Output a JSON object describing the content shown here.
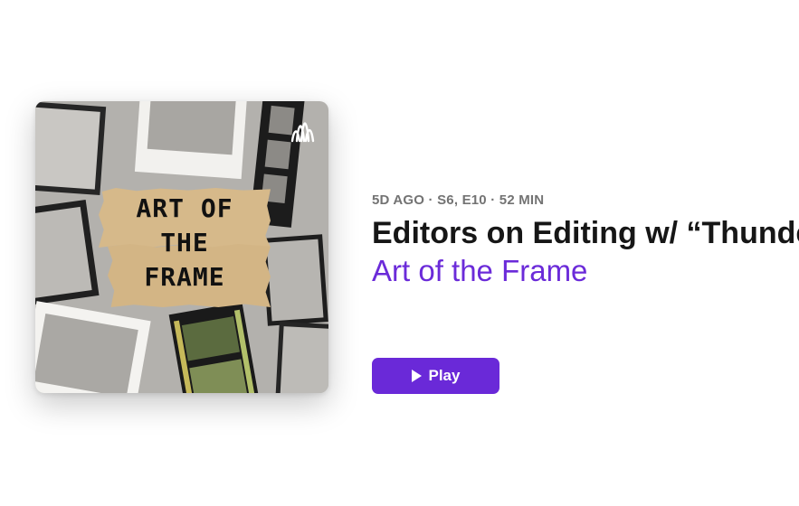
{
  "artwork": {
    "title_lines": [
      "ART OF",
      "THE",
      "FRAME"
    ],
    "badge_icon": "podcast-waveform-icon"
  },
  "episode": {
    "meta": "5D AGO · S6, E10 · 52 MIN",
    "title": "Editors on Editing w/ “Thunderbolts*” Editor",
    "show_name": "Art of the Frame"
  },
  "actions": {
    "play_label": "Play",
    "play_icon": "play-icon"
  },
  "colors": {
    "accent": "#6a29d8",
    "show_name": "#6b2bd9",
    "meta": "#737373",
    "title": "#161616"
  }
}
